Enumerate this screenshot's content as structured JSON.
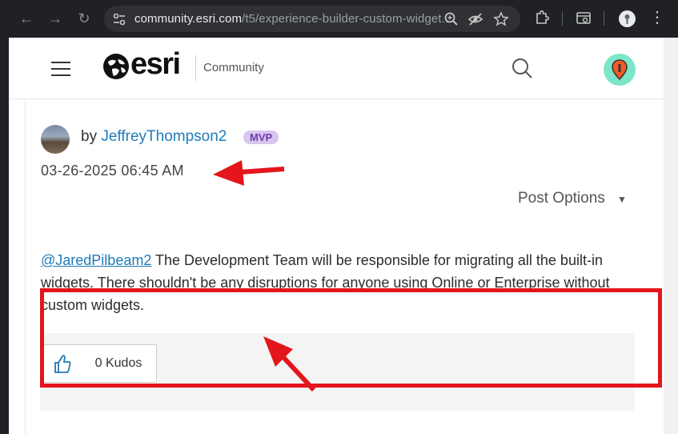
{
  "browser": {
    "url_host": "community.esri.com",
    "url_path": "/t5/experience-builder-custom-widget...",
    "back_icon": "back-arrow-icon",
    "forward_icon": "forward-arrow-icon",
    "reload_icon": "reload-icon"
  },
  "header": {
    "brand": "esri",
    "community_label": "Community"
  },
  "post": {
    "by_prefix": "by ",
    "author": "JeffreyThompson2",
    "badge": "MVP",
    "date": "03-26-2025 06:45 AM",
    "options_label": "Post Options",
    "options_caret": "▼",
    "mention": "@JaredPilbeam2",
    "body_text": " The Development Team will be responsible for migrating all the built-in widgets. There shouldn't be any disruptions for anyone using Online or Enterprise without custom widgets.",
    "kudos_label": "0 Kudos"
  },
  "colors": {
    "annotation_red": "#e3161b",
    "link_blue": "#1f7bb8",
    "mvp_purple": "#6f3bb0"
  }
}
